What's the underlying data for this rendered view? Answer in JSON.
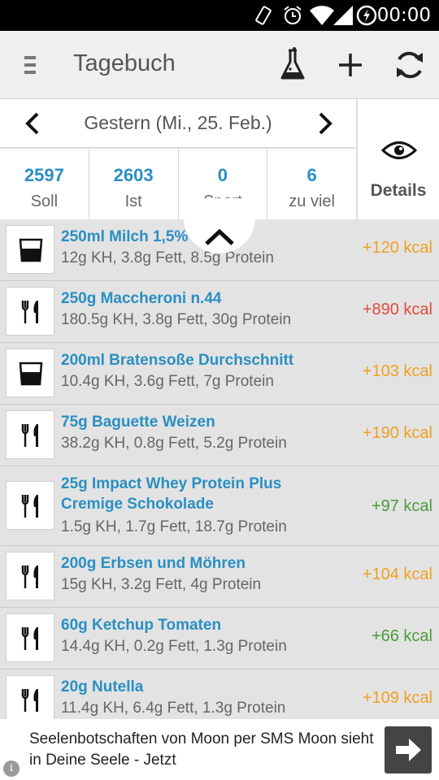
{
  "status_bar": {
    "time": "00:00",
    "icons": [
      "vibrate-icon",
      "alarm-icon",
      "wifi-icon",
      "signal-icon",
      "battery-charging-icon"
    ]
  },
  "action_bar": {
    "title": "Tagebuch",
    "icons": [
      "menu-icon",
      "flask-icon",
      "add-icon",
      "sync-icon"
    ]
  },
  "date_nav": {
    "label": "Gestern (Mi., 25. Feb.)"
  },
  "stats": [
    {
      "value": "2597",
      "label": "Soll"
    },
    {
      "value": "2603",
      "label": "Ist"
    },
    {
      "value": "0",
      "label": "Sport"
    },
    {
      "value": "6",
      "label": "zu viel"
    }
  ],
  "details": {
    "label": "Details"
  },
  "entries": [
    {
      "name": "250ml Milch 1,5%",
      "macros": "12g KH,  3.8g Fett,  8.5g Protein",
      "kcal": "+120 kcal",
      "kcal_color": "#f0a020",
      "icon": "glass-icon"
    },
    {
      "name": "250g Maccheroni n.44",
      "macros": "180.5g KH,  3.8g Fett,  30g Protein",
      "kcal": "+890 kcal",
      "kcal_color": "#e04a3a",
      "icon": "cutlery-icon"
    },
    {
      "name": "200ml Bratensoße Durchschnitt",
      "macros": "10.4g KH,  3.6g Fett,  7g Protein",
      "kcal": "+103 kcal",
      "kcal_color": "#f0a020",
      "icon": "glass-icon"
    },
    {
      "name": "75g Baguette Weizen",
      "macros": "38.2g KH,  0.8g Fett,  5.2g Protein",
      "kcal": "+190 kcal",
      "kcal_color": "#f0a020",
      "icon": "cutlery-icon"
    },
    {
      "name": "25g Impact Whey Protein Plus Cremige Schokolade",
      "macros": "1.5g KH,  1.7g Fett,  18.7g Protein",
      "kcal": "+97 kcal",
      "kcal_color": "#4a9a3a",
      "icon": "cutlery-icon"
    },
    {
      "name": "200g Erbsen und Möhren",
      "macros": "15g KH,  3.2g Fett,  4g Protein",
      "kcal": "+104 kcal",
      "kcal_color": "#f0a020",
      "icon": "cutlery-icon"
    },
    {
      "name": "60g Ketchup Tomaten",
      "macros": "14.4g KH,  0.2g Fett,  1.3g Protein",
      "kcal": "+66 kcal",
      "kcal_color": "#4a9a3a",
      "icon": "cutlery-icon"
    },
    {
      "name": "20g Nutella",
      "macros": "11.4g KH,  6.4g Fett,  1.3g Protein",
      "kcal": "+109 kcal",
      "kcal_color": "#f0a020",
      "icon": "cutlery-icon"
    }
  ],
  "ad": {
    "text": "Seelenbotschaften von Moon per SMS Moon sieht in Deine Seele - Jetzt",
    "info": "i"
  }
}
